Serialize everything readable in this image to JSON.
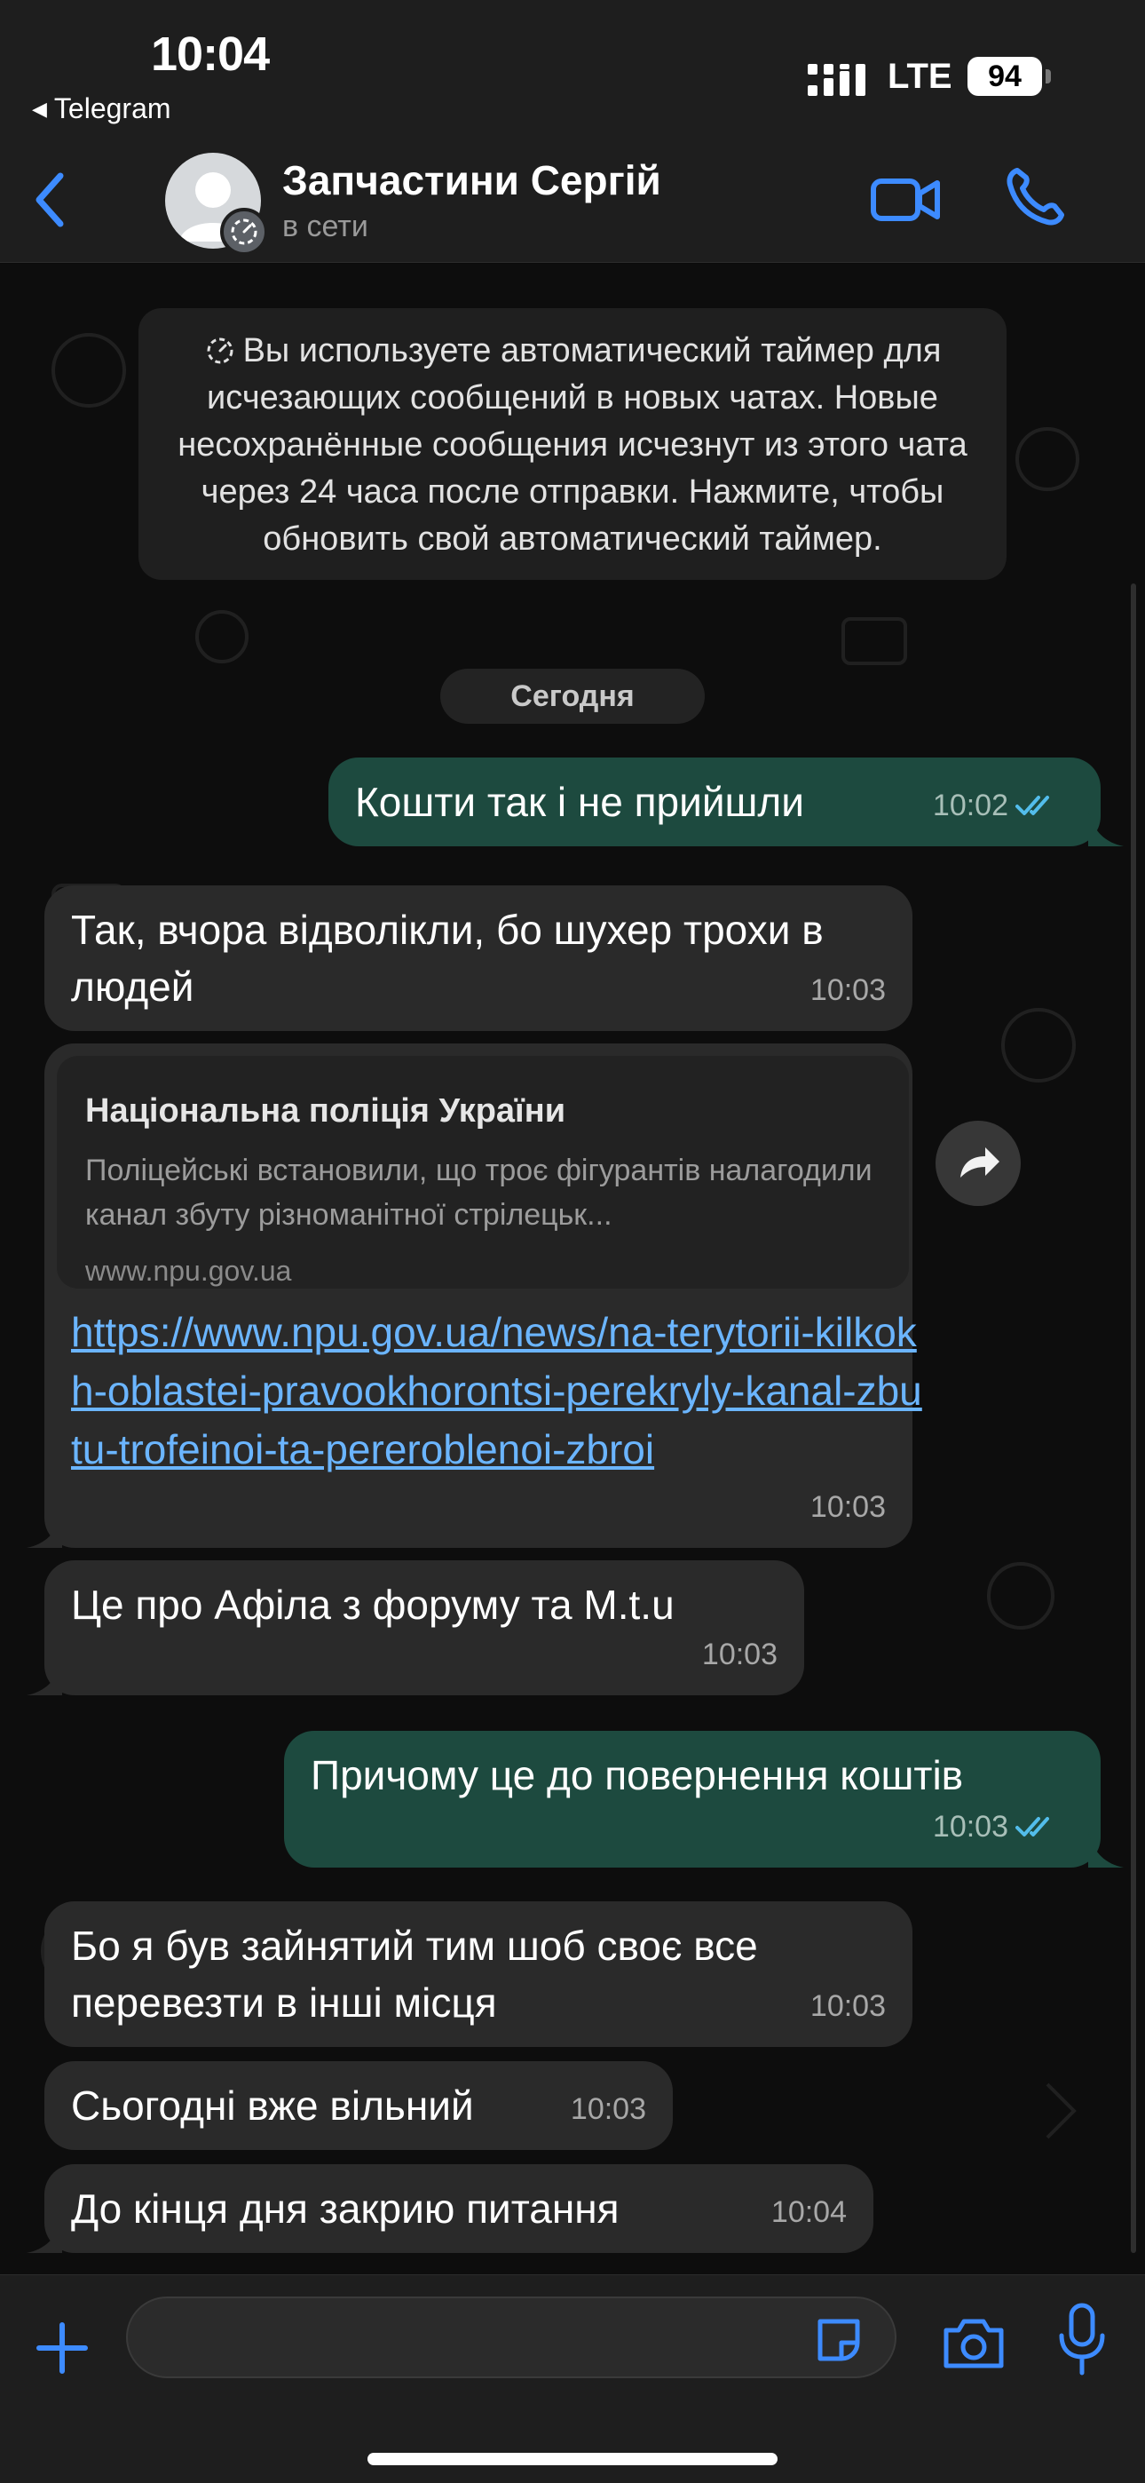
{
  "status_bar": {
    "time": "10:04",
    "back_app": "Telegram",
    "network": "LTE",
    "battery": "94"
  },
  "header": {
    "contact_name": "Запчастини Сергій",
    "status": "в сети",
    "accent_color": "#3d8bff"
  },
  "system_note": {
    "text": "Вы используете автоматический таймер для исчезающих сообщений в новых чатах. Новые несохранённые сообщения исчезнут из этого чата через 24 часа после отправки. Нажмите, чтобы обновить свой автоматический таймер."
  },
  "date_divider": "Сегодня",
  "messages": [
    {
      "direction": "out",
      "text": "Кошти так і не прийшли",
      "time": "10:02",
      "read": true
    },
    {
      "direction": "in",
      "text": "Так, вчора відволікли, бо шухер трохи в людей",
      "time": "10:03"
    },
    {
      "direction": "in",
      "link_preview": {
        "title": "Національна поліція України",
        "description": "Поліцейські встановили, що троє фігурантів налагодили канал збуту різноманітної стрілецьк...",
        "domain": "www.npu.gov.ua"
      },
      "text": "https://www.npu.gov.ua/news/na-terytorii-kilkokh-oblastei-pravookhorontsi-perekryly-kanal-zbutu-trofeinoi-ta-pereroblenoi-zbroi",
      "time": "10:03"
    },
    {
      "direction": "in",
      "text": "Це про Афіла з форуму та M.t.u",
      "time": "10:03"
    },
    {
      "direction": "out",
      "text": "Причому це до повернення коштів",
      "time": "10:03",
      "read": true
    },
    {
      "direction": "in",
      "text": "Бо я був зайнятий тим шоб своє все перевезти в інші місця",
      "time": "10:03"
    },
    {
      "direction": "in",
      "text": "Сьогодні вже вільний",
      "time": "10:03"
    },
    {
      "direction": "in",
      "text": "До кінця дня закрию питання",
      "time": "10:04"
    }
  ],
  "colors": {
    "outgoing_bubble": "#1d4a3f",
    "incoming_bubble": "#2a2a2a",
    "link": "#6bb5ff",
    "read_ticks": "#53bdeb"
  }
}
